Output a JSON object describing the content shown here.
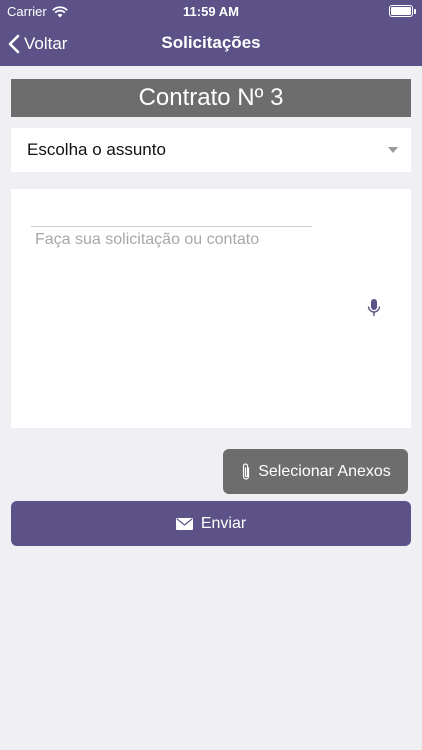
{
  "status_bar": {
    "carrier": "Carrier",
    "time": "11:59 AM",
    "wifi_icon": "wifi-icon",
    "battery_icon": "battery-icon"
  },
  "navbar": {
    "back_label": "Voltar",
    "title": "Solicitações",
    "back_icon": "chevron-left-icon"
  },
  "contract": {
    "title": "Contrato Nº 3"
  },
  "subject": {
    "value": "Escolha o assunto",
    "dropdown_icon": "chevron-down-icon"
  },
  "message": {
    "placeholder": "Faça sua solicitação ou contato",
    "value": "",
    "mic_icon": "microphone-icon"
  },
  "attachments": {
    "label": "Selecionar Anexos",
    "icon": "paperclip-icon"
  },
  "send": {
    "label": "Enviar",
    "icon": "envelope-icon"
  },
  "colors": {
    "accent": "#5c5287",
    "gray_button": "#6d6d6d",
    "background": "#efeff4"
  }
}
